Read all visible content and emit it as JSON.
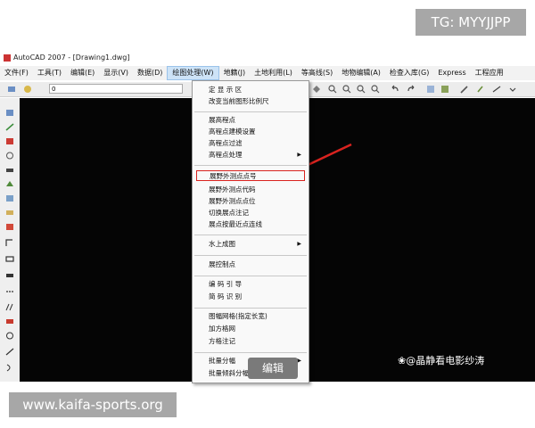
{
  "watermark_top": "TG: MYYJJPP",
  "window": {
    "title": "AutoCAD 2007 - [Drawing1.dwg]"
  },
  "menubar": {
    "items": [
      "文件(F)",
      "工具(T)",
      "编辑(E)",
      "显示(V)",
      "数据(D)",
      "绘图处理(W)",
      "地籍(J)",
      "土地利用(L)",
      "等高线(S)",
      "地物编辑(A)",
      "检查入库(G)",
      "Express",
      "工程应用"
    ]
  },
  "toolbar": {
    "layer_combo": "0"
  },
  "dropdown": {
    "items": [
      "定 显 示 区",
      "改变当前图形比例尺",
      "展高程点",
      "高程点建模设置",
      "高程点过滤",
      "高程点处理",
      "展野外测点点号",
      "展野外测点代码",
      "展野外测点点位",
      "切换展点注记",
      "展点按最近点连线",
      "水上成图",
      "展控制点",
      "编 码 引 导",
      "简 码 识 别",
      "图幅网格(指定长宽)",
      "加方格网",
      "方格注记",
      "批量分幅",
      "批量倾斜分幅"
    ],
    "highlighted": "展野外测点点号"
  },
  "tooltip": "编辑",
  "credit": "❀@晶静看电影纱涛",
  "watermark_bottom": "www.kaifa-sports.org",
  "colors": {
    "annotation": "#d9231f",
    "canvas": "#050505"
  }
}
